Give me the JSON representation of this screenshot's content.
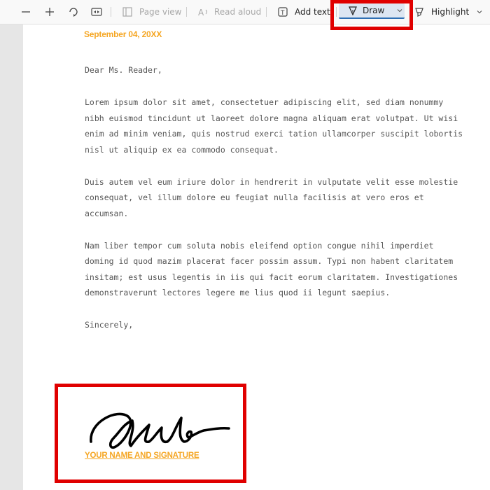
{
  "toolbar": {
    "zoom_out": "zoom-out",
    "zoom_in": "zoom-in",
    "rotate": "rotate",
    "fit": "fit-width",
    "page_view_label": "Page view",
    "read_aloud_label": "Read aloud",
    "add_text_label": "Add text",
    "draw_label": "Draw",
    "highlight_label": "Highlight"
  },
  "document": {
    "date": "September 04, 20XX",
    "greeting": "Dear Ms. Reader,",
    "para1": [
      "Lorem ipsum dolor sit amet, consectetuer adipiscing elit, sed diam nonummy",
      "nibh euismod tincidunt ut laoreet dolore magna aliquam erat volutpat. Ut wisi",
      "enim ad minim veniam, quis nostrud exerci tation ullamcorper suscipit lobortis",
      "nisl ut aliquip ex ea commodo consequat."
    ],
    "para2": [
      "Duis autem vel eum iriure dolor in hendrerit in vulputate velit esse molestie",
      "consequat, vel illum dolore eu feugiat nulla facilisis at vero eros et",
      "accumsan."
    ],
    "para3": [
      "Nam liber tempor cum soluta nobis eleifend option congue nihil imperdiet",
      "doming id quod mazim placerat facer possim assum. Typi non habent claritatem",
      "insitam; est usus legentis in iis qui facit eorum claritatem. Investigationes",
      "demonstraverunt lectores legere me lius quod ii legunt saepius."
    ],
    "closing": "Sincerely,",
    "signature_label": "YOUR NAME AND SIGNATURE"
  },
  "colors": {
    "accent_orange": "#f5a623",
    "highlight_red": "#e00000",
    "draw_active": "#dde6f2"
  }
}
